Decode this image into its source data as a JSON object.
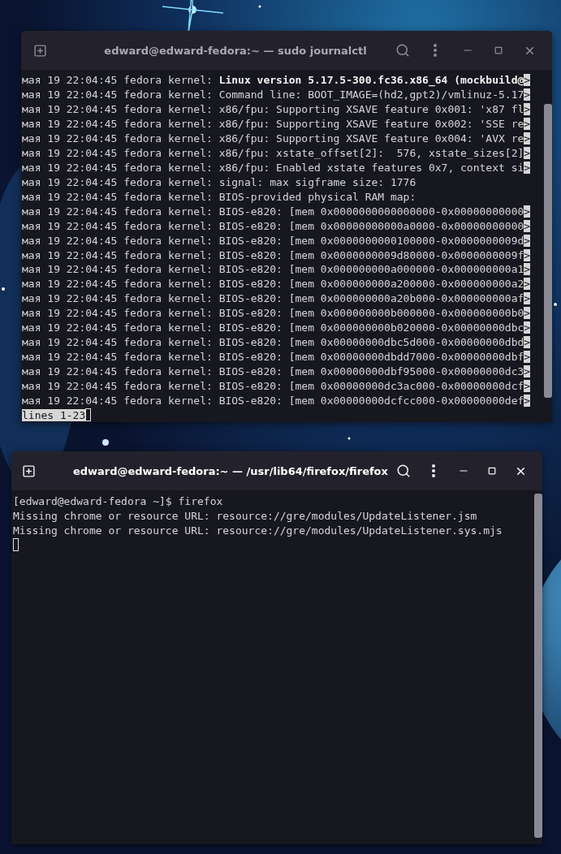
{
  "windows": [
    {
      "title": "edward@edward-fedora:~ — sudo journalctl",
      "focused": false,
      "lines": [
        {
          "text": "мая 19 22:04:45 fedora kernel: **Linux version 5.17.5-300.fc36.x86_64 (mockbuild@**",
          "overflow": ">"
        },
        {
          "text": "мая 19 22:04:45 fedora kernel: Command line: BOOT_IMAGE=(hd2,gpt2)/vmlinuz-5.17",
          "overflow": ">"
        },
        {
          "text": "мая 19 22:04:45 fedora kernel: x86/fpu: Supporting XSAVE feature 0x001: 'x87 fl",
          "overflow": ">"
        },
        {
          "text": "мая 19 22:04:45 fedora kernel: x86/fpu: Supporting XSAVE feature 0x002: 'SSE re",
          "overflow": ">"
        },
        {
          "text": "мая 19 22:04:45 fedora kernel: x86/fpu: Supporting XSAVE feature 0x004: 'AVX re",
          "overflow": ">"
        },
        {
          "text": "мая 19 22:04:45 fedora kernel: x86/fpu: xstate_offset[2]:  576, xstate_sizes[2]",
          "overflow": ">"
        },
        {
          "text": "мая 19 22:04:45 fedora kernel: x86/fpu: Enabled xstate features 0x7, context si",
          "overflow": ">"
        },
        {
          "text": "мая 19 22:04:45 fedora kernel: signal: max sigframe size: 1776"
        },
        {
          "text": "мая 19 22:04:45 fedora kernel: BIOS-provided physical RAM map:"
        },
        {
          "text": "мая 19 22:04:45 fedora kernel: BIOS-e820: [mem 0x0000000000000000-0x00000000000",
          "overflow": ">"
        },
        {
          "text": "мая 19 22:04:45 fedora kernel: BIOS-e820: [mem 0x00000000000a0000-0x00000000000",
          "overflow": ">"
        },
        {
          "text": "мая 19 22:04:45 fedora kernel: BIOS-e820: [mem 0x0000000000100000-0x0000000009d",
          "overflow": ">"
        },
        {
          "text": "мая 19 22:04:45 fedora kernel: BIOS-e820: [mem 0x0000000009d80000-0x0000000009f",
          "overflow": ">"
        },
        {
          "text": "мая 19 22:04:45 fedora kernel: BIOS-e820: [mem 0x000000000a000000-0x000000000a1",
          "overflow": ">"
        },
        {
          "text": "мая 19 22:04:45 fedora kernel: BIOS-e820: [mem 0x000000000a200000-0x000000000a2",
          "overflow": ">"
        },
        {
          "text": "мая 19 22:04:45 fedora kernel: BIOS-e820: [mem 0x000000000a20b000-0x000000000af",
          "overflow": ">"
        },
        {
          "text": "мая 19 22:04:45 fedora kernel: BIOS-e820: [mem 0x000000000b000000-0x000000000b0",
          "overflow": ">"
        },
        {
          "text": "мая 19 22:04:45 fedora kernel: BIOS-e820: [mem 0x000000000b020000-0x00000000dbc",
          "overflow": ">"
        },
        {
          "text": "мая 19 22:04:45 fedora kernel: BIOS-e820: [mem 0x00000000dbc5d000-0x00000000dbd",
          "overflow": ">"
        },
        {
          "text": "мая 19 22:04:45 fedora kernel: BIOS-e820: [mem 0x00000000dbdd7000-0x00000000dbf",
          "overflow": ">"
        },
        {
          "text": "мая 19 22:04:45 fedora kernel: BIOS-e820: [mem 0x00000000dbf95000-0x00000000dc3",
          "overflow": ">"
        },
        {
          "text": "мая 19 22:04:45 fedora kernel: BIOS-e820: [mem 0x00000000dc3ac000-0x00000000dcf",
          "overflow": ">"
        },
        {
          "text": "мая 19 22:04:45 fedora kernel: BIOS-e820: [mem 0x00000000dcfcc000-0x00000000def",
          "overflow": ">"
        }
      ],
      "pager_status": "lines 1-23"
    },
    {
      "title": "edward@edward-fedora:~ — /usr/lib64/firefox/firefox",
      "focused": true,
      "lines": [
        {
          "text": "[edward@edward-fedora ~]$ firefox"
        },
        {
          "text": "Missing chrome or resource URL: resource://gre/modules/UpdateListener.jsm"
        },
        {
          "text": "Missing chrome or resource URL: resource://gre/modules/UpdateListener.sys.mjs"
        }
      ]
    }
  ]
}
